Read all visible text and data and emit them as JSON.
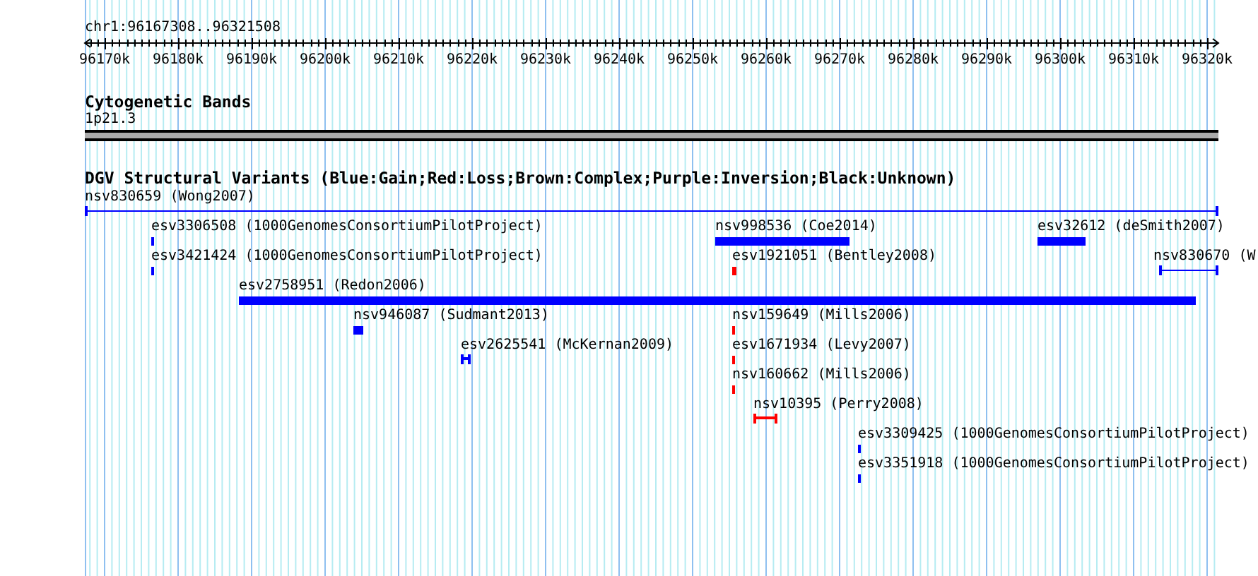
{
  "ruler": {
    "region": "chr1:96167308..96321508",
    "ticks": [
      "96170k",
      "96180k",
      "96190k",
      "96200k",
      "96210k",
      "96220k",
      "96230k",
      "96240k",
      "96250k",
      "96260k",
      "96270k",
      "96280k",
      "96290k",
      "96300k",
      "96310k",
      "96320k"
    ]
  },
  "cytoband_track": {
    "title": "Cytogenetic Bands",
    "band_label": "1p21.3"
  },
  "variant_track": {
    "title": "DGV Structural Variants (Blue:Gain;Red:Loss;Brown:Complex;Purple:Inversion;Black:Unknown)",
    "features": [
      {
        "label": "nsv830659 (Wong2007)",
        "kind": "line",
        "color": "#0000ff"
      },
      {
        "label": "esv3306508 (1000GenomesConsortiumPilotProject)",
        "kind": "bar",
        "color": "#0000ff"
      },
      {
        "label": "nsv998536 (Coe2014)",
        "kind": "bar",
        "color": "#0000ff"
      },
      {
        "label": "esv32612 (deSmith2007)",
        "kind": "bar",
        "color": "#0000ff"
      },
      {
        "label": "esv3421424 (1000GenomesConsortiumPilotProject)",
        "kind": "bar",
        "color": "#0000ff"
      },
      {
        "label": "esv1921051 (Bentley2008)",
        "kind": "bar",
        "color": "#ff0000"
      },
      {
        "label": "nsv830670 (W",
        "kind": "line",
        "color": "#0000ff"
      },
      {
        "label": "esv2758951 (Redon2006)",
        "kind": "bar",
        "color": "#0000ff"
      },
      {
        "label": "nsv946087 (Sudmant2013)",
        "kind": "bar",
        "color": "#0000ff"
      },
      {
        "label": "nsv159649 (Mills2006)",
        "kind": "bar",
        "color": "#ff0000"
      },
      {
        "label": "esv2625541 (McKernan2009)",
        "kind": "interval",
        "color": "#0000ff"
      },
      {
        "label": "esv1671934 (Levy2007)",
        "kind": "bar",
        "color": "#ff0000"
      },
      {
        "label": "nsv160662 (Mills2006)",
        "kind": "bar",
        "color": "#ff0000"
      },
      {
        "label": "nsv10395 (Perry2008)",
        "kind": "interval",
        "color": "#ff0000"
      },
      {
        "label": "esv3309425 (1000GenomesConsortiumPilotProject)",
        "kind": "bar",
        "color": "#0000ff"
      },
      {
        "label": "esv3351918 (1000GenomesConsortiumPilotProject)",
        "kind": "bar",
        "color": "#0000ff"
      }
    ]
  }
}
